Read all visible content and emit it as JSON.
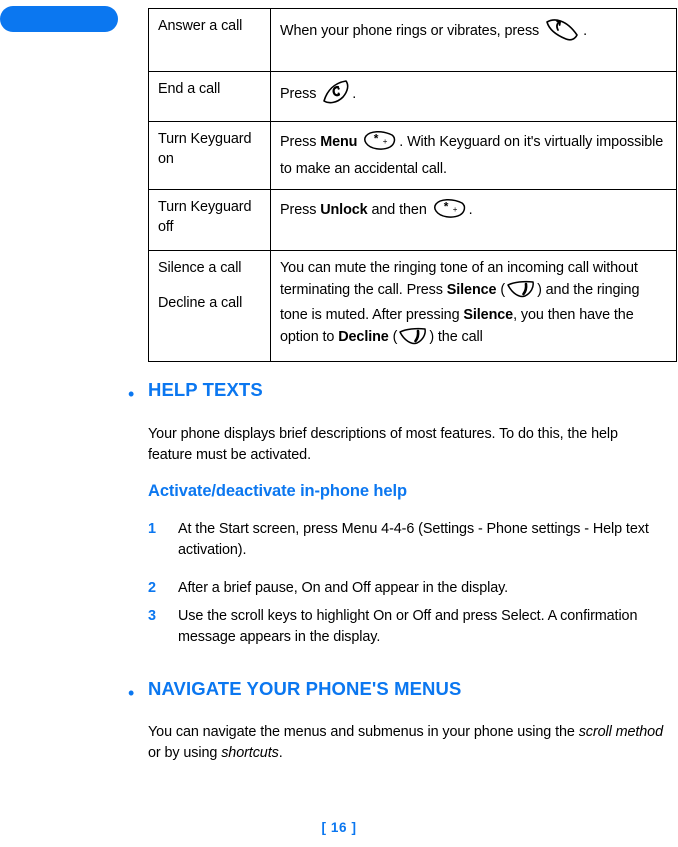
{
  "page": {
    "footer_label": "[ 16 ]",
    "accent_color": "#0b77f0",
    "text_color": "#000000",
    "background_color": "#ffffff"
  },
  "edge_tab": {
    "name": "chapter-tab",
    "color": "#0b77f0"
  },
  "key_table": {
    "rows": [
      {
        "label": "Answer a call",
        "desc_pre": "When your phone rings or vibrates, press",
        "icon": "send-key-icon",
        "desc_post": "."
      },
      {
        "label": "End a call",
        "desc_pre": "Press",
        "icon": "end-key-icon",
        "desc_post": "."
      },
      {
        "label": "Turn Keyguard on",
        "desc_pre": "Press",
        "desc_bold": "Menu",
        "icon": "asterisk-key-icon",
        "desc_post": ". With Keyguard on it's virtually impossible to make an accidental call."
      },
      {
        "label": "Turn Keyguard off",
        "desc_pre": "Press",
        "desc_bold": "Unlock",
        "desc_mid": "and then",
        "icon": "asterisk-key-icon",
        "desc_post": "."
      },
      {
        "label_a": "Silence a call",
        "label_b": "Decline a call",
        "seg1": "You can mute the ringing tone of an incoming call without terminating the call. Press ",
        "seg2_bold": "Silence",
        "seg3": " (",
        "icon1": "right-softkey-icon",
        "seg4": ") and the ringing tone is muted. After pressing ",
        "seg5_bold": "Silence",
        "seg6": ", you then have the option to ",
        "seg7_bold": "Decline",
        "seg8": " (",
        "icon2": "right-softkey-icon",
        "seg9": ") the call"
      }
    ]
  },
  "help_texts": {
    "heading": "HELP TEXTS",
    "paragraph": "Your phone displays brief descriptions of most features. To do this, the help feature must be activated.",
    "sub_heading": "Activate/deactivate in-phone help",
    "steps": [
      {
        "number": "1",
        "text": "At the Start screen, press Menu 4-4-6 (Settings - Phone settings - Help text activation)."
      },
      {
        "number": "2",
        "text": "After a brief pause, On and Off appear in the display."
      },
      {
        "number": "3",
        "text": "Use the scroll keys to highlight On or Off and press Select. A confirmation message appears in the display."
      }
    ]
  },
  "navigate_menus": {
    "heading": "NAVIGATE YOUR PHONE'S MENUS",
    "paragraph_part1": "You can navigate the menus and submenus in your phone using the ",
    "paragraph_italic1": "scroll method",
    "paragraph_part2": " or by using ",
    "paragraph_italic2": "shortcuts",
    "paragraph_part3": "."
  }
}
